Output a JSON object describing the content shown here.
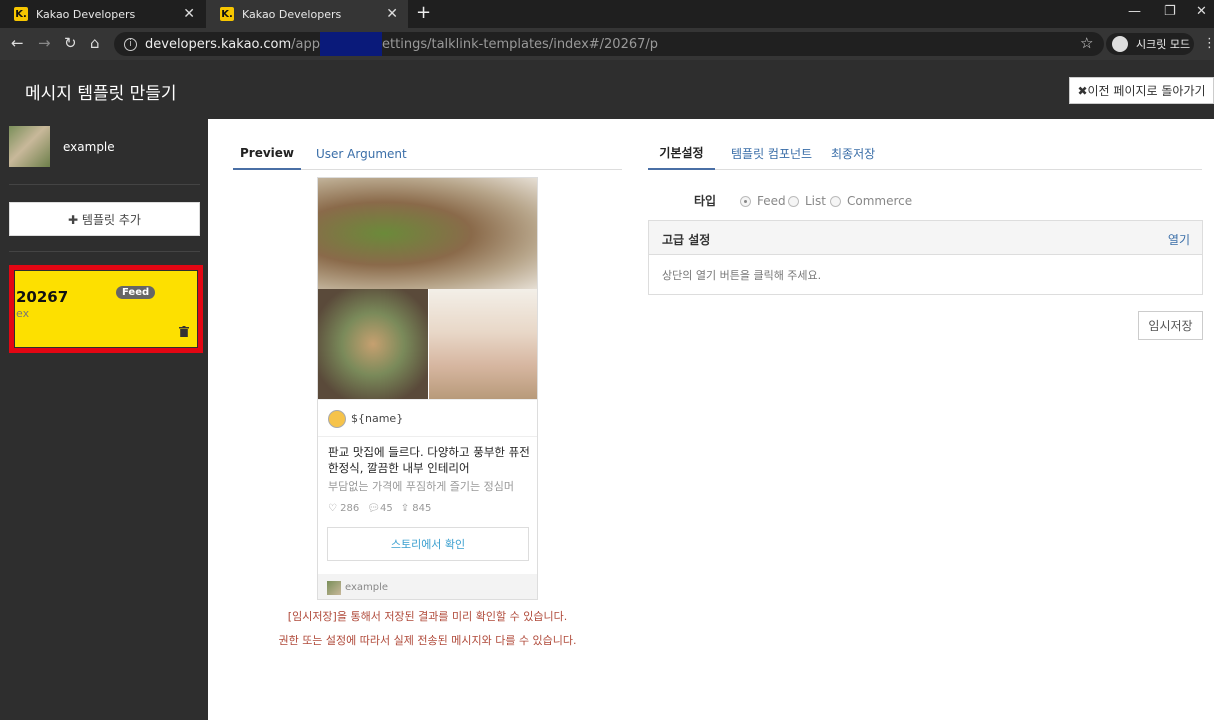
{
  "browser": {
    "tabs": [
      {
        "title": "Kakao Developers",
        "favicon": "K."
      },
      {
        "title": "Kakao Developers",
        "favicon": "K."
      }
    ],
    "url_host": "developers.kakao.com",
    "url_pre": "/app",
    "url_post": "ettings/talklink-templates/index#/20267/p",
    "incognito_label": "시크릿 모드"
  },
  "header": {
    "title": "메시지 템플릿 만들기",
    "back_label": "✖이전 페이지로 돌아가기"
  },
  "sidebar": {
    "profile_name": "example",
    "add_template_label": "✚ 템플릿 추가",
    "templates": [
      {
        "id": "20267",
        "desc": "ex",
        "badge": "Feed"
      }
    ]
  },
  "preview": {
    "tabs": [
      "Preview",
      "User Argument"
    ],
    "message": {
      "profile_text": "${name}",
      "title": "판교 맛집에 들르다. 다양하고 풍부한 퓨전 한정식, 깔끔한 내부 인테리어",
      "description": "부담없는 가격에 푸짐하게 즐기는 정심머",
      "likes": "286",
      "comments": "45",
      "shares": "845",
      "button_label": "스토리에서 확인",
      "footer_name": "example"
    },
    "note1": "[임시저장]을 통해서 저장된 결과를 미리 확인할 수 있습니다.",
    "note2": "권한 또는 설정에 따라서 실제 전송된 메시지와 다를 수 있습니다."
  },
  "settings": {
    "tabs": [
      "기본설정",
      "템플릿 컴포넌트",
      "최종저장"
    ],
    "type_label": "타입",
    "types": [
      "Feed",
      "List",
      "Commerce"
    ],
    "selected_type": "Feed",
    "advanced": {
      "title": "고급 설정",
      "open_label": "열기",
      "body": "상단의 열기 버튼을 클릭해 주세요."
    },
    "temp_save_label": "임시저장"
  },
  "colors": {
    "card_bg": "#fde000",
    "card_border": "#e30613",
    "link": "#3a6ea8"
  }
}
